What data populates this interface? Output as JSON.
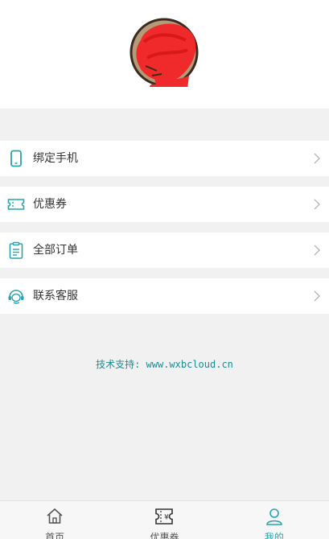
{
  "profile": {
    "avatar_icon": "avatar-redacted-icon"
  },
  "menu": {
    "items": [
      {
        "label": "绑定手机",
        "icon": "phone-icon"
      },
      {
        "label": "优惠券",
        "icon": "ticket-icon"
      },
      {
        "label": "全部订单",
        "icon": "clipboard-icon"
      },
      {
        "label": "联系客服",
        "icon": "headset-icon"
      }
    ]
  },
  "support_text": "技术支持: www.wxbcloud.cn",
  "tabbar": {
    "tabs": [
      {
        "label": "首页",
        "icon": "home-icon",
        "active": false
      },
      {
        "label": "优惠券",
        "icon": "coupon-icon",
        "active": false
      },
      {
        "label": "我的",
        "icon": "user-icon",
        "active": true
      }
    ]
  },
  "colors": {
    "accent": "#2aa4ad",
    "text": "#333333",
    "background": "#f1f1f1",
    "redaction": "#f02a2a"
  }
}
